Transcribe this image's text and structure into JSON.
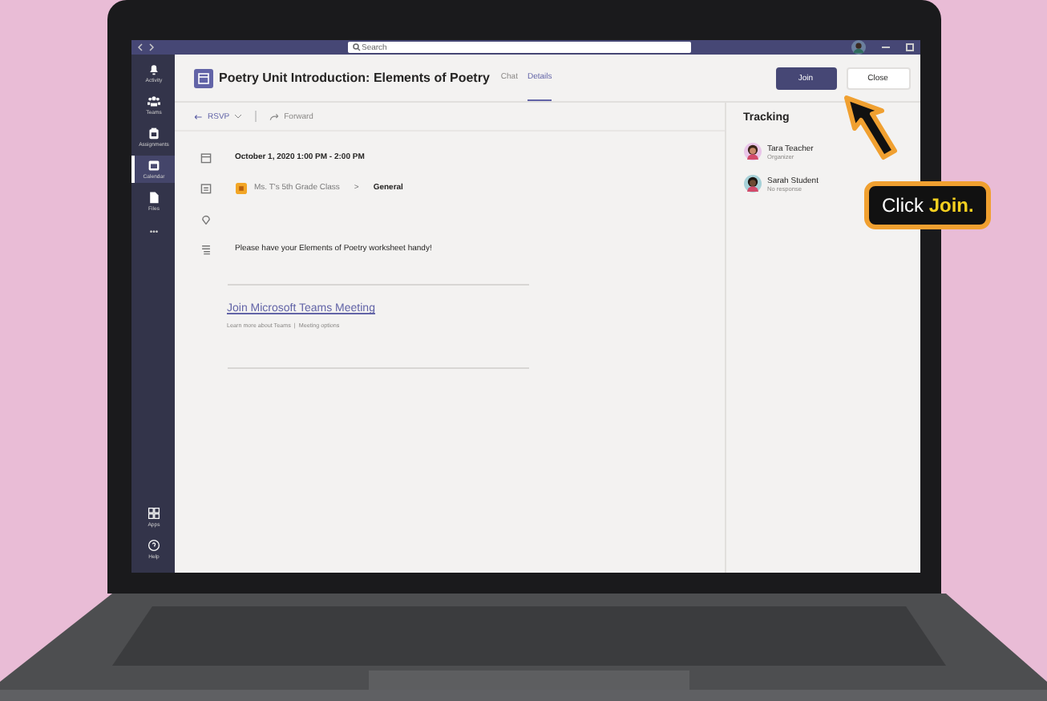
{
  "title_bar": {
    "search_placeholder": "Search"
  },
  "rail": {
    "items": [
      {
        "kind": "bell",
        "label": "Activity",
        "selected": false
      },
      {
        "kind": "people",
        "label": "Teams",
        "selected": false
      },
      {
        "kind": "bag",
        "label": "Assignments",
        "selected": false
      },
      {
        "kind": "calendar",
        "label": "Calendar",
        "selected": true
      },
      {
        "kind": "file",
        "label": "Files",
        "selected": false
      },
      {
        "kind": "more",
        "label": "•••",
        "selected": false
      }
    ],
    "bottom_items": [
      {
        "kind": "apps",
        "label": "Apps"
      },
      {
        "kind": "help",
        "label": "Help"
      }
    ]
  },
  "meeting": {
    "title": "Poetry Unit Introduction: Elements of Poetry",
    "tabs": [
      {
        "label": "Chat",
        "selected": false
      },
      {
        "label": "Details",
        "selected": true
      }
    ],
    "buttons": [
      {
        "label": "Join",
        "kind": "primary"
      },
      {
        "label": "Close",
        "kind": "secondary"
      }
    ],
    "toolbar": [
      {
        "label": "RSVP",
        "kind": "rsvp"
      },
      {
        "label": "Forward",
        "kind": "forward"
      }
    ],
    "details": [
      {
        "kind": "date",
        "text": "October 1, 2020 1:00 PM - 2:00 PM"
      },
      {
        "kind": "channel",
        "team": "Ms. T's 5th Grade Class",
        "separator": ">",
        "channel": "General"
      },
      {
        "kind": "location"
      },
      {
        "kind": "note",
        "text": "Please have your Elements of Poetry worksheet handy!"
      }
    ],
    "join_link": "Join Microsoft Teams Meeting",
    "sub_links": [
      "Learn more about Teams",
      "|",
      "Meeting options"
    ]
  },
  "tracking": {
    "title": "Tracking",
    "people": [
      {
        "name": "Tara Teacher",
        "status": "Organizer"
      },
      {
        "name": "Sarah Student",
        "status": "No response"
      }
    ]
  },
  "callout": {
    "text": "Click **Join.**"
  }
}
